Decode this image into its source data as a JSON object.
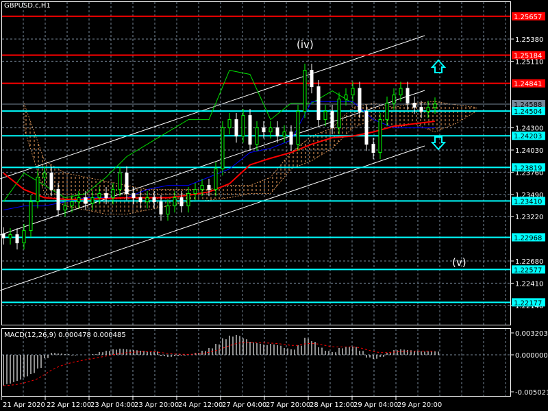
{
  "window": {
    "title": "GBPUSD.c,H1"
  },
  "colors": {
    "background": "#000000",
    "grid": "#778899",
    "bull": "#00ff00",
    "bear": "#ffffff",
    "resistance": "#ff0000",
    "support": "#00ffff",
    "kijun": "#ff0000",
    "tenkan": "#0000ff",
    "chikou": "#00dd00",
    "cloud": "#f4a460",
    "macd_signal": "#ff0000",
    "macd_hist": "#c0c0c0"
  },
  "price_axis": {
    "ticks": [
      "1.25380",
      "1.25110",
      "1.24300",
      "1.24030",
      "1.23760",
      "1.23490",
      "1.23220",
      "1.22680",
      "1.22410",
      "1.22140"
    ],
    "levels": [
      {
        "price": "1.25657",
        "kind": "resistance"
      },
      {
        "price": "1.25184",
        "kind": "resistance"
      },
      {
        "price": "1.24841",
        "kind": "resistance"
      },
      {
        "price": "1.24588",
        "kind": "current"
      },
      {
        "price": "1.24504",
        "kind": "support"
      },
      {
        "price": "1.24203",
        "kind": "support"
      },
      {
        "price": "1.23819",
        "kind": "support"
      },
      {
        "price": "1.23410",
        "kind": "support"
      },
      {
        "price": "1.22968",
        "kind": "support"
      },
      {
        "price": "1.22577",
        "kind": "support"
      },
      {
        "price": "1.22177",
        "kind": "support"
      }
    ]
  },
  "time_axis": {
    "labels": [
      "21 Apr 2020",
      "22 Apr 12:00",
      "23 Apr 04:00",
      "23 Apr 20:00",
      "24 Apr 12:00",
      "27 Apr 04:00",
      "27 Apr 20:00",
      "28 Apr 12:00",
      "29 Apr 04:00",
      "29 Apr 20:00"
    ]
  },
  "annotations": {
    "wave_iv": "(iv)",
    "wave_v": "(v)",
    "arrow_up": "arrow-up-icon",
    "arrow_down": "arrow-down-icon"
  },
  "macd": {
    "label": "MACD(12,26,9) 0.000478 0.000485",
    "ticks": [
      "0.003203",
      "0.000000",
      "-0.005021"
    ]
  },
  "chart_data": {
    "type": "candlestick",
    "symbol": "GBPUSD.c",
    "timeframe": "H1",
    "ylim": [
      1.22,
      1.258
    ],
    "closes": [
      1.2296,
      1.23,
      1.229,
      1.2305,
      1.234,
      1.237,
      1.2375,
      1.2355,
      1.233,
      1.2335,
      1.234,
      1.2345,
      1.2338,
      1.2345,
      1.235,
      1.2345,
      1.2355,
      1.2375,
      1.235,
      1.2345,
      1.234,
      1.2345,
      1.234,
      1.2325,
      1.2335,
      1.2345,
      1.2335,
      1.235,
      1.2355,
      1.236,
      1.2355,
      1.238,
      1.243,
      1.244,
      1.242,
      1.2445,
      1.241,
      1.243,
      1.2425,
      1.243,
      1.242,
      1.2425,
      1.241,
      1.245,
      1.25,
      1.248,
      1.244,
      1.245,
      1.243,
      1.2465,
      1.247,
      1.2478,
      1.245,
      1.241,
      1.24,
      1.244,
      1.246,
      1.247,
      1.2478,
      1.246,
      1.2455,
      1.245,
      1.2455,
      1.2459
    ],
    "kijun": [
      1.2375,
      1.2355,
      1.2345,
      1.2343,
      1.2343,
      1.2344,
      1.2345,
      1.2345,
      1.2345,
      1.2348,
      1.2352,
      1.2362,
      1.2385,
      1.2393,
      1.24,
      1.241,
      1.2418,
      1.242,
      1.2425,
      1.2432,
      1.2435,
      1.2438
    ],
    "tenkan": [
      1.233,
      1.2335,
      1.2335,
      1.234,
      1.2345,
      1.2345,
      1.2345,
      1.2355,
      1.236,
      1.236,
      1.237,
      1.238,
      1.24,
      1.2405,
      1.2415,
      1.2462,
      1.2462,
      1.2462,
      1.244,
      1.243,
      1.243,
      1.243
    ],
    "chikou": [
      1.234,
      1.2375,
      1.236,
      1.2345,
      1.235,
      1.237,
      1.2395,
      1.241,
      1.2425,
      1.244,
      1.244,
      1.25,
      1.2495,
      1.244,
      1.246,
      1.246,
      1.2475,
      1.246
    ],
    "cloud_upper": [
      1.246,
      1.239,
      1.2375,
      1.237,
      1.2365,
      1.236,
      1.2355,
      1.2355,
      1.2355,
      1.2355,
      1.236,
      1.236,
      1.237,
      1.24,
      1.242,
      1.243,
      1.2455,
      1.246,
      1.2455,
      1.246,
      1.2462,
      1.2458,
      1.2455
    ],
    "cloud_lower": [
      1.243,
      1.235,
      1.2335,
      1.233,
      1.2325,
      1.2325,
      1.233,
      1.2335,
      1.234,
      1.2342,
      1.2345,
      1.235,
      1.235,
      1.238,
      1.239,
      1.2405,
      1.243,
      1.244,
      1.243,
      1.2435,
      1.2425,
      1.2435,
      1.245
    ],
    "macd_hist": [
      -0.0045,
      -0.0042,
      -0.0038,
      -0.0033,
      -0.0028,
      -0.002,
      -0.0005,
      0.0003,
      0.0002,
      0.0001,
      -0.0001,
      0.0,
      0.0,
      0.0001,
      0.0004,
      0.0006,
      0.0008,
      0.0009,
      0.0008,
      0.0007,
      0.0006,
      0.0005,
      0.0005,
      -0.0002,
      -0.0003,
      -0.0002,
      -0.0001,
      0.0,
      0.0003,
      0.0006,
      0.001,
      0.0016,
      0.0024,
      0.0028,
      0.0029,
      0.0024,
      0.0019,
      0.0017,
      0.0015,
      0.0016,
      0.0014,
      0.001,
      0.0008,
      0.0014,
      0.0025,
      0.002,
      0.0011,
      0.0006,
      0.0004,
      0.001,
      0.0012,
      0.0012,
      0.0006,
      -0.0004,
      -0.0006,
      -0.0003,
      0.0003,
      0.0007,
      0.0008,
      0.0007,
      0.0006,
      0.0005,
      0.0005,
      0.0005
    ]
  }
}
